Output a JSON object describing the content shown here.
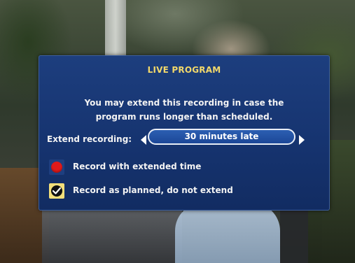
{
  "dialog": {
    "title": "LIVE PROGRAM",
    "message_line1": "You may extend this recording in case the",
    "message_line2": "program runs longer than scheduled.",
    "extend_label": "Extend recording:",
    "extend_value": "30 minutes late",
    "options": [
      {
        "label": "Record with extended time",
        "icon": "record-dot-icon",
        "color": "#e01a1a"
      },
      {
        "label": "Record as planned, do not extend",
        "icon": "checkmark-icon",
        "color": "#f3df7a"
      }
    ],
    "colors": {
      "background": "#163470",
      "title": "#f2d86a",
      "text": "#f3f3f3",
      "pill": "#2c5fb2"
    }
  }
}
